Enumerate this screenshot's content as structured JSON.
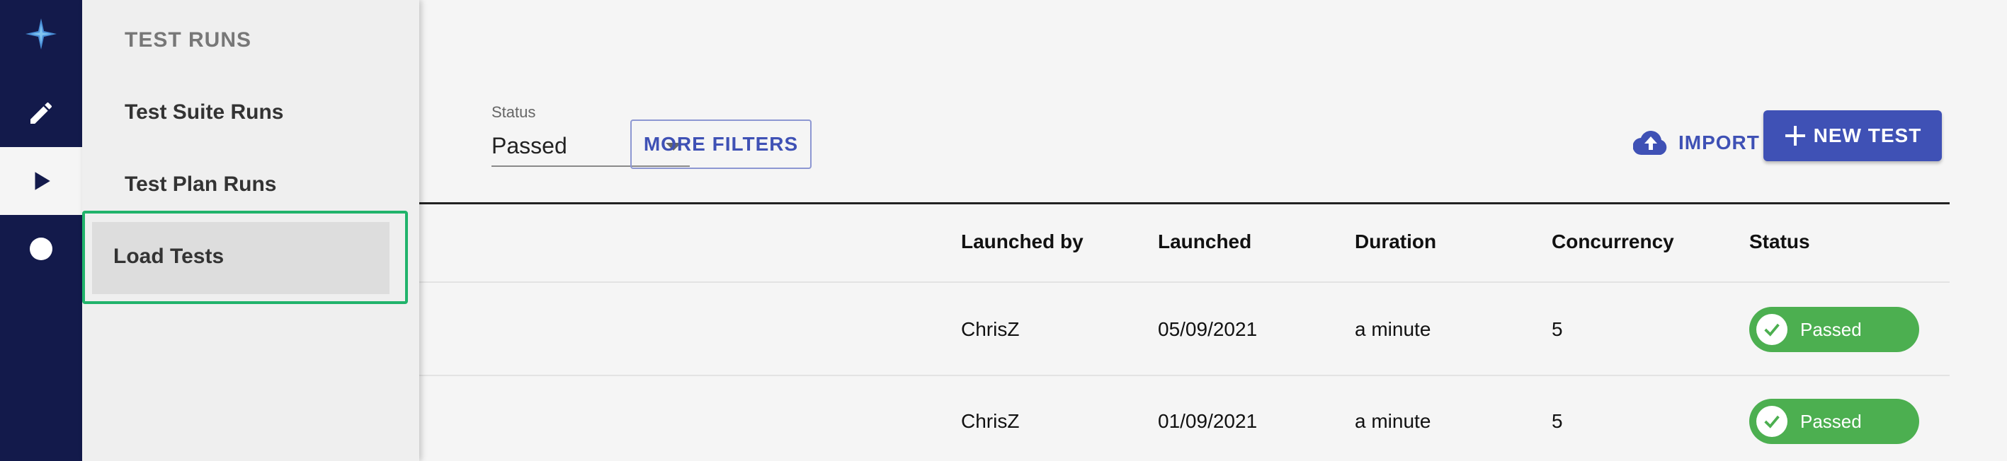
{
  "colors": {
    "rail": "#131a4b",
    "accent": "#3f51b5",
    "passed": "#4caf50",
    "highlight": "#21b36b"
  },
  "rail": {
    "items": [
      {
        "icon": "app-logo-icon"
      },
      {
        "icon": "pencil-icon"
      },
      {
        "icon": "play-icon",
        "active": true
      },
      {
        "icon": "circle-icon"
      }
    ]
  },
  "menu": {
    "title": "TEST RUNS",
    "items": [
      "Test Suite Runs",
      "Test Plan Runs",
      "Load Tests"
    ],
    "selected": "Load Tests"
  },
  "filters": {
    "status_label": "Status",
    "status_value": "Passed",
    "more_filters": "MORE FILTERS"
  },
  "toolbar": {
    "import_label": "IMPORT TEST",
    "new_label": "NEW TEST"
  },
  "table": {
    "columns": [
      "Launched by",
      "Launched",
      "Duration",
      "Concurrency",
      "Status"
    ],
    "rows": [
      {
        "launched_by": "ChrisZ",
        "launched": "05/09/2021",
        "duration": "a minute",
        "concurrency": "5",
        "status": "Passed"
      },
      {
        "launched_by": "ChrisZ",
        "launched": "01/09/2021",
        "duration": "a minute",
        "concurrency": "5",
        "status": "Passed"
      }
    ]
  }
}
